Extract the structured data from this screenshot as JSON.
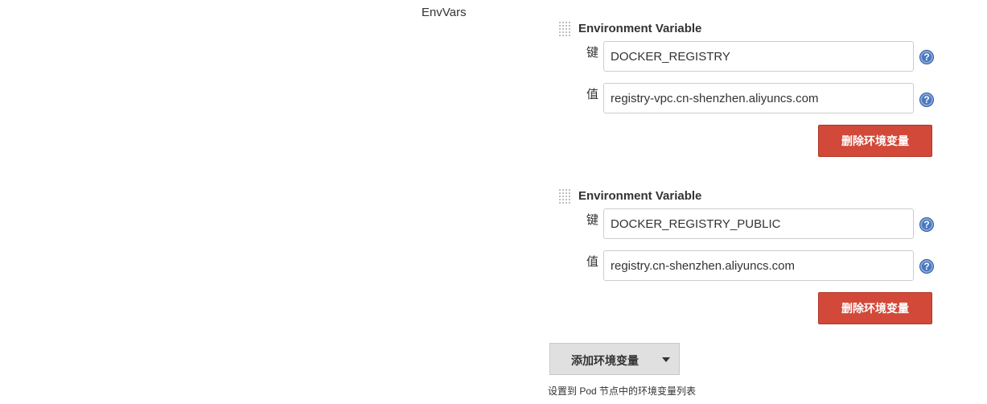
{
  "section": {
    "label": "EnvVars"
  },
  "env_vars": [
    {
      "title": "Environment Variable",
      "key_label": "键",
      "key_value": "DOCKER_REGISTRY",
      "value_label": "值",
      "value_value": "registry-vpc.cn-shenzhen.aliyuncs.com",
      "help_glyph": "?",
      "delete_label": "删除环境变量"
    },
    {
      "title": "Environment Variable",
      "key_label": "键",
      "key_value": "DOCKER_REGISTRY_PUBLIC",
      "value_label": "值",
      "value_value": "registry.cn-shenzhen.aliyuncs.com",
      "help_glyph": "?",
      "delete_label": "删除环境变量"
    }
  ],
  "add_button": {
    "label": "添加环境变量",
    "icon": "chevron-down-icon"
  },
  "description": "设置到 Pod 节点中的环境变量列表",
  "colors": {
    "delete": "#d24939",
    "help": "#4b77be",
    "add_bg": "#e0e0e0"
  }
}
